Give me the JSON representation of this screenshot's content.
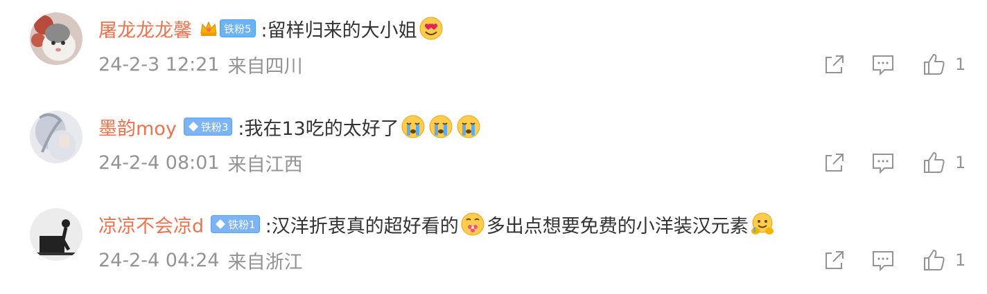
{
  "comments": [
    {
      "username": "屠龙龙龙馨",
      "badge_level": "铁粉5",
      "badge_style": "gold-crown",
      "text_parts": [
        ":留样归来的大小姐"
      ],
      "emojis": [
        "heart-eyes-emoji"
      ],
      "timestamp": "24-2-3 12:21",
      "location": "来自四川",
      "like_count": "1"
    },
    {
      "username": "墨韵moy",
      "badge_level": "铁粉3",
      "badge_style": "blue-diamond",
      "text_parts": [
        ":我在13吃的太好了"
      ],
      "emojis": [
        "crying-emoji",
        "crying-emoji",
        "crying-emoji"
      ],
      "timestamp": "24-2-4 08:01",
      "location": "来自江西",
      "like_count": "1"
    },
    {
      "username": "凉凉不会凉d",
      "badge_level": "铁粉1",
      "badge_style": "blue-diamond",
      "text_parts": [
        ":汉洋折衷真的超好看的",
        "多出点想要免费的小洋装汉元素"
      ],
      "emojis": [
        "flower-emoji",
        "hug-emoji"
      ],
      "timestamp": "24-2-4 04:24",
      "location": "来自浙江",
      "like_count": "1"
    }
  ],
  "colors": {
    "username": "#eb7350",
    "body_text": "#333333",
    "meta_text": "#939393",
    "badge_blue": "#7cb4f5"
  }
}
